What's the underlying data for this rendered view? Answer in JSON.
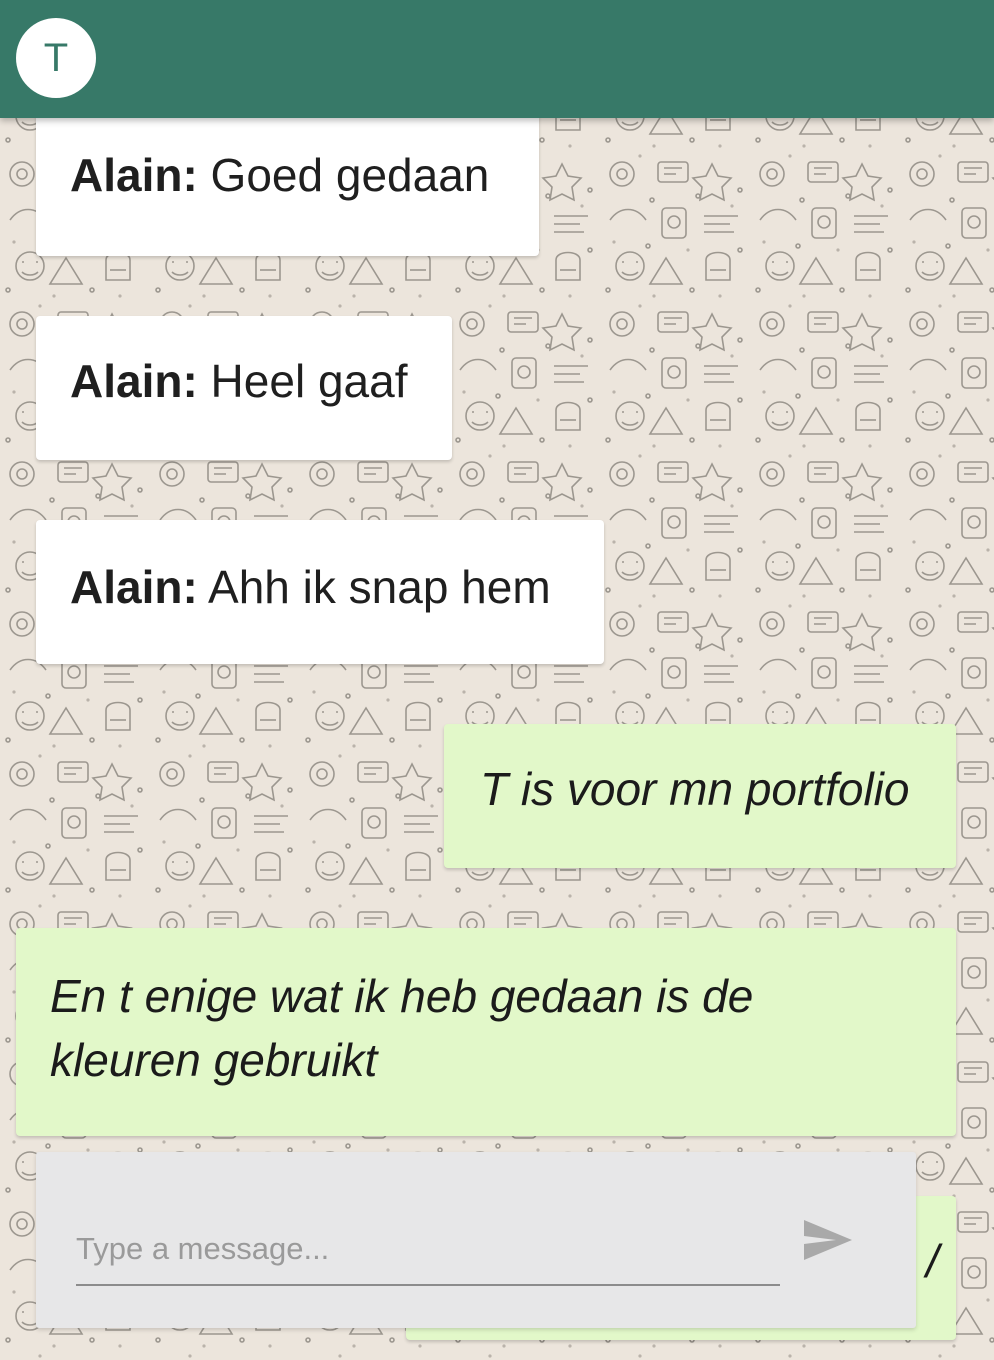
{
  "header": {
    "avatar_letter": "T",
    "color": "#377968"
  },
  "messages": [
    {
      "direction": "incoming",
      "sender": "Alain:",
      "text": " Goed gedaan"
    },
    {
      "direction": "incoming",
      "sender": "Alain:",
      "text": " Heel gaaf"
    },
    {
      "direction": "incoming",
      "sender": "Alain:",
      "text": " Ahh ik snap hem"
    },
    {
      "direction": "outgoing",
      "text": "T is voor mn portfolio"
    },
    {
      "direction": "outgoing",
      "text": "En t enige wat ik heb gedaan is de kleuren gebruikt"
    },
    {
      "direction": "outgoing",
      "text": "/"
    }
  ],
  "composer": {
    "placeholder": "Type a message...",
    "value": "",
    "send_icon": "send-icon"
  },
  "colors": {
    "background": "#ece5dc",
    "incoming_bubble": "#ffffff",
    "outgoing_bubble": "#e2f8c9"
  }
}
